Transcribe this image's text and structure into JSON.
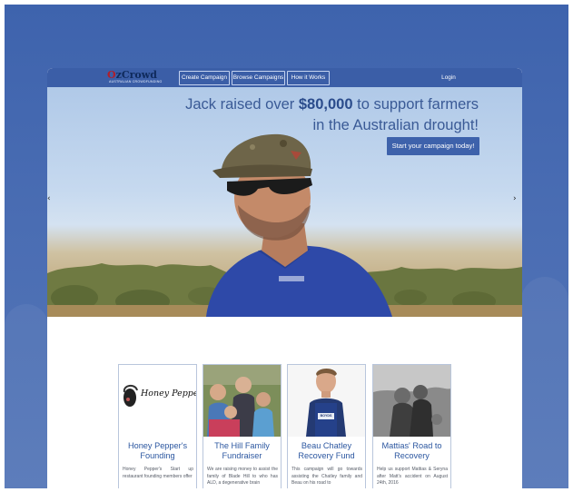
{
  "logo": {
    "name": "OzCrowd",
    "tagline": "AUSTRALIAN CROWDFUNDING"
  },
  "nav": {
    "create_label": "Create Campaign",
    "browse_label": "Browse Campaigns",
    "how_label": "How it Works",
    "login_label": "Login"
  },
  "hero": {
    "headline_pre": "Jack raised over",
    "headline_amount": "$80,000",
    "headline_post": "to support farmers in the Australian drought!",
    "cta_label": "Start your campaign today!",
    "arrow_left": "‹",
    "arrow_right": "›"
  },
  "cards": [
    {
      "title": "Honey Pepper's Founding",
      "desc": "Honey Pepper's Start up restaurant founding members offer",
      "thumb_text": "Honey Pepper's"
    },
    {
      "title": "The Hill Family Fundraiser",
      "desc": "We are raising money to assist the family of Blade Hill to who has ALD, a degenerative brain"
    },
    {
      "title": "Beau Chatley Recovery Fund",
      "desc": "This campaign will go towards assisting the Chatley family and Beau on his road to",
      "thumb_text": "BOYDS"
    },
    {
      "title": "Mattias' Road to Recovery",
      "desc": "Help us support Mattias & Seryna after Matt's accident on August 24th, 2016"
    }
  ],
  "colors": {
    "brand_blue": "#3b5ea7",
    "card_title": "#2c57a0",
    "backdrop": "#4a6db3"
  }
}
